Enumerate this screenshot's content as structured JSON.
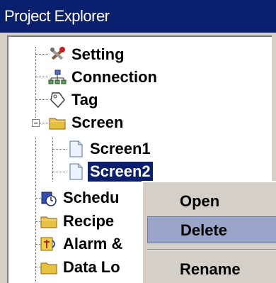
{
  "window": {
    "title": "Project Explorer"
  },
  "tree": {
    "items": [
      {
        "label": "Setting",
        "icon": "tools-icon"
      },
      {
        "label": "Connection",
        "icon": "network-icon"
      },
      {
        "label": "Tag",
        "icon": "tag-icon"
      },
      {
        "label": "Screen",
        "icon": "folder-icon"
      },
      {
        "label": "Screen1",
        "icon": "document-icon"
      },
      {
        "label": "Screen2",
        "icon": "document-icon",
        "selected": true
      },
      {
        "label": "Schedu",
        "icon": "schedule-icon"
      },
      {
        "label": "Recipe",
        "icon": "folder-icon"
      },
      {
        "label": "Alarm &",
        "icon": "alarm-icon"
      },
      {
        "label": "Data Lo",
        "icon": "folder-icon"
      }
    ]
  },
  "context_menu": {
    "items": [
      {
        "label": "Open"
      },
      {
        "label": "Delete",
        "highlighted": true
      },
      {
        "label": "Rename"
      }
    ]
  },
  "colors": {
    "titlebar": "#0a1f6e",
    "selection": "#0a1f6e",
    "menu_highlight": "#9aa4c8",
    "panel": "#d4d0c8"
  }
}
